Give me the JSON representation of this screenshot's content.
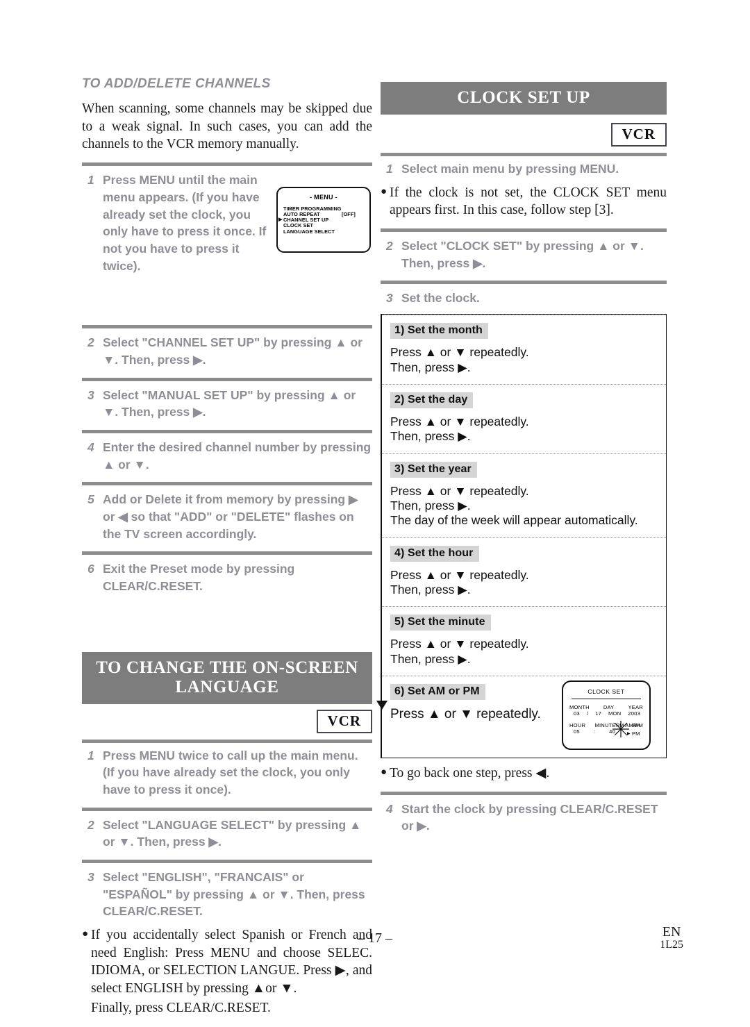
{
  "left_column": {
    "section_title": "TO ADD/DELETE CHANNELS",
    "intro_paragraph": "When scanning, some channels may be skipped due to a weak signal. In such cases, you can add  the channels to the VCR memory manually.",
    "steps": [
      {
        "num": "1",
        "text": "Press MENU until the main menu appears. (If you have already set the clock, you only have to press it once.  If not you have to press it twice)."
      },
      {
        "num": "2",
        "text": "Select \"CHANNEL SET UP\" by pressing ▲ or ▼. Then, press ▶."
      },
      {
        "num": "3",
        "text": "Select \"MANUAL SET UP\" by pressing ▲ or ▼. Then, press ▶."
      },
      {
        "num": "4",
        "text": "Enter the desired channel number by pressing ▲ or ▼."
      },
      {
        "num": "5",
        "text": "Add or Delete it from memory by pressing ▶ or ◀ so that \"ADD\" or \"DELETE\" flashes on the TV screen accordingly."
      },
      {
        "num": "6",
        "text": "Exit the Preset mode by pressing CLEAR/C.RESET."
      }
    ],
    "osd_menu": {
      "title": "- MENU -",
      "items": [
        {
          "label": "TIMER PROGRAMMING",
          "value": "",
          "cursor": false
        },
        {
          "label": "AUTO REPEAT",
          "value": "[OFF]",
          "cursor": false
        },
        {
          "label": "CHANNEL SET UP",
          "value": "",
          "cursor": true
        },
        {
          "label": "CLOCK SET",
          "value": "",
          "cursor": false
        },
        {
          "label": "LANGUAGE SELECT",
          "value": "",
          "cursor": false
        }
      ]
    },
    "language_section": {
      "banner_line1": "TO CHANGE THE ON-SCREEN",
      "banner_line2": "LANGUAGE",
      "vcr_badge": "VCR",
      "steps": [
        {
          "num": "1",
          "text": "Press MENU twice to call up the main menu. (If you have already set the clock, you only have to press it once)."
        },
        {
          "num": "2",
          "text": "Select \"LANGUAGE SELECT\" by pressing ▲ or ▼. Then, press ▶."
        },
        {
          "num": "3",
          "text": "Select \"ENGLISH\", \"FRANCAIS\" or \"ESPAÑOL\" by pressing ▲ or ▼. Then, press CLEAR/C.RESET."
        }
      ],
      "note": "If you accidentally select Spanish or French and need English: Press MENU and choose SELEC. IDIOMA, or SELECTION LANGUE. Press ▶, and select ENGLISH by pressing ▲or ▼.",
      "note_last_line": "Finally, press CLEAR/C.RESET."
    }
  },
  "right_column": {
    "banner": "CLOCK SET UP",
    "vcr_badge": "VCR",
    "step1": {
      "num": "1",
      "text": "Select main menu by pressing MENU."
    },
    "note1": "If the clock is not set, the CLOCK SET menu appears first. In this case, follow step [3].",
    "step2": {
      "num": "2",
      "text": "Select \"CLOCK SET\" by pressing ▲ or ▼. Then, press ▶."
    },
    "step3": {
      "num": "3",
      "text": "Set the clock."
    },
    "clock_steps": [
      {
        "label": "1) Set the month",
        "lines": [
          "Press ▲ or ▼ repeatedly.",
          "Then, press ▶."
        ]
      },
      {
        "label": "2) Set the day",
        "lines": [
          "Press ▲ or ▼ repeatedly.",
          "Then, press ▶."
        ]
      },
      {
        "label": "3) Set the year",
        "lines": [
          "Press ▲ or ▼ repeatedly.",
          "Then, press ▶.",
          "The day of the week will appear automatically."
        ]
      },
      {
        "label": "4) Set the hour",
        "lines": [
          "Press ▲ or ▼ repeatedly.",
          "Then, press ▶."
        ]
      },
      {
        "label": "5) Set the minute",
        "lines": [
          "Press ▲ or ▼ repeatedly.",
          "Then, press ▶."
        ]
      },
      {
        "label": "6) Set AM or PM",
        "lines": [
          "Press  ▲ or ▼ repeatedly."
        ]
      }
    ],
    "osd_clock": {
      "title": "CLOCK SET",
      "hdr_month": "MONTH",
      "hdr_day": "DAY",
      "hdr_year": "YEAR",
      "val_month": "03",
      "val_sep1": "/",
      "val_day": "17",
      "val_weekday": "MON",
      "val_year": "2003",
      "hdr_hour": "HOUR",
      "hdr_minute": "MINUTE",
      "hdr_ampm": "AM/PM",
      "val_hour": "05",
      "val_sep2": ":",
      "val_minute": "40",
      "val_pm_left": "PM",
      "val_am_right": "AM",
      "val_pm_right": "PM"
    },
    "note2": "To go back one step, press ◀.",
    "step4": {
      "num": "4",
      "text": "Start the clock by pressing CLEAR/C.RESET or ▶."
    }
  },
  "footer": {
    "page_number": "– 17 –",
    "lang_code": "EN",
    "doc_code": "1L25"
  },
  "colors": {
    "banner_gray": "#7d7d7d",
    "rule_gray": "#8c8c8c",
    "step_text_gray": "#8e8e96",
    "label_bg_gray": "#d5d5d5",
    "body_black": "#1a1a1a"
  }
}
